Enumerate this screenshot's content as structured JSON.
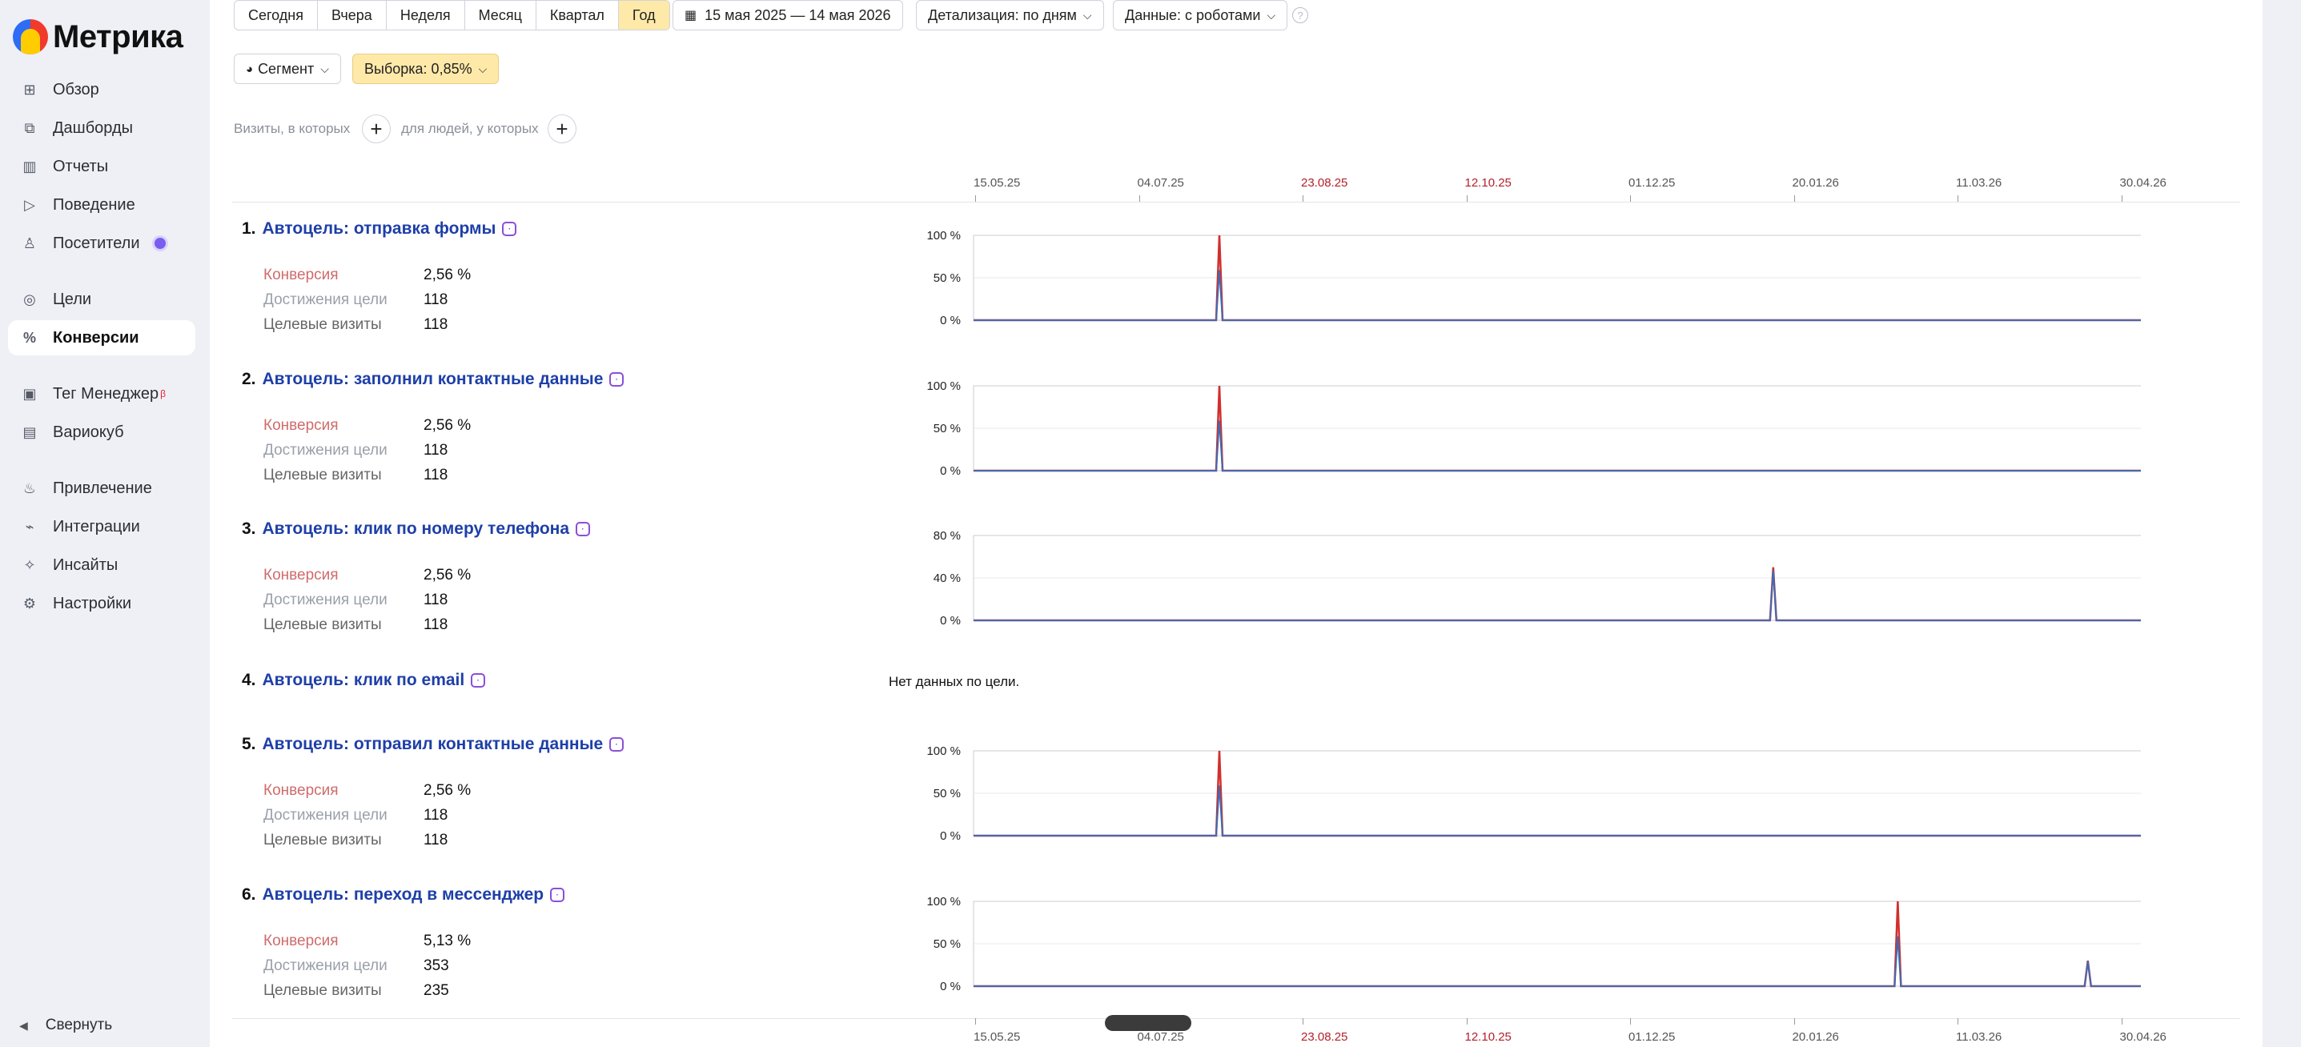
{
  "app": {
    "logo_text": "Метрика"
  },
  "sidebar": {
    "items": [
      {
        "label": "Обзор",
        "icon": "grid-icon",
        "glyph": "⊞"
      },
      {
        "label": "Дашборды",
        "icon": "dashboards-icon",
        "glyph": "⧉"
      },
      {
        "label": "Отчеты",
        "icon": "bar-chart-icon",
        "glyph": "▥"
      },
      {
        "label": "Поведение",
        "icon": "play-icon",
        "glyph": "▷"
      },
      {
        "label": "Посетители",
        "icon": "user-icon",
        "glyph": "♙"
      },
      {
        "label": "Цели",
        "icon": "target-icon",
        "glyph": "◎"
      },
      {
        "label": "Конверсии",
        "icon": "percent-icon",
        "glyph": "%"
      },
      {
        "label": "Тег Менеджер",
        "icon": "tag-manager-icon",
        "glyph": "▣",
        "badge": "β"
      },
      {
        "label": "Вариокуб",
        "icon": "variocube-icon",
        "glyph": "▤"
      },
      {
        "label": "Привлечение",
        "icon": "fire-icon",
        "glyph": "♨"
      },
      {
        "label": "Интеграции",
        "icon": "plug-icon",
        "glyph": "⌁"
      },
      {
        "label": "Инсайты",
        "icon": "wand-icon",
        "glyph": "✧"
      },
      {
        "label": "Настройки",
        "icon": "gear-icon",
        "glyph": "⚙"
      }
    ],
    "collapse_label": "Свернуть"
  },
  "toolbar": {
    "periods": [
      "Сегодня",
      "Вчера",
      "Неделя",
      "Месяц",
      "Квартал",
      "Год"
    ],
    "active_period": "Год",
    "date_range": "15 мая 2025 — 14 мая 2026",
    "detail": "Детализация: по дням",
    "robots": "Данные: с роботами",
    "segment": "Сегмент",
    "sample": "Выборка: 0,85%"
  },
  "filters": {
    "visits_label": "Визиты, в которых",
    "people_label": "для людей, у которых"
  },
  "axis_dates": [
    {
      "label": "15.05.25",
      "red": false
    },
    {
      "label": "04.07.25",
      "red": false
    },
    {
      "label": "23.08.25",
      "red": true
    },
    {
      "label": "12.10.25",
      "red": true
    },
    {
      "label": "01.12.25",
      "red": false
    },
    {
      "label": "20.01.26",
      "red": false
    },
    {
      "label": "11.03.26",
      "red": false
    },
    {
      "label": "30.04.26",
      "red": false
    }
  ],
  "metric_labels": {
    "conversion": "Конверсия",
    "achievements": "Достижения цели",
    "visits": "Целевые визиты"
  },
  "goals": [
    {
      "num": "1.",
      "title": "Автоцель: отправка формы",
      "icon": "form-icon",
      "conversion": "2,56 %",
      "achievements": "118",
      "visits": "118"
    },
    {
      "num": "2.",
      "title": "Автоцель: заполнил контактные данные",
      "icon": "contact-icon",
      "conversion": "2,56 %",
      "achievements": "118",
      "visits": "118"
    },
    {
      "num": "3.",
      "title": "Автоцель: клик по номеру телефона",
      "icon": "phone-icon",
      "conversion": "2,56 %",
      "achievements": "118",
      "visits": "118"
    },
    {
      "num": "4.",
      "title": "Автоцель: клик по email",
      "icon": "email-icon",
      "no_data": "Нет данных по цели."
    },
    {
      "num": "5.",
      "title": "Автоцель: отправил контактные данные",
      "icon": "contact-icon",
      "conversion": "2,56 %",
      "achievements": "118",
      "visits": "118"
    },
    {
      "num": "6.",
      "title": "Автоцель: переход в мессенджер",
      "icon": "messenger-icon",
      "conversion": "5,13 %",
      "achievements": "353",
      "visits": "235"
    }
  ],
  "chart_data": [
    {
      "type": "line",
      "goal": "Автоцель: отправка формы",
      "x_range": [
        "15.05.25",
        "14.05.26"
      ],
      "left_ticks": [
        "100 %",
        "50 %",
        "0 %"
      ],
      "right_ticks": [
        "200",
        "100",
        "0"
      ],
      "series": [
        {
          "color": "#d0302c",
          "peaks": [
            {
              "x": "29.07.25",
              "value": 100
            }
          ]
        },
        {
          "color": "#3f6bb5",
          "peaks": [
            {
              "x": "29.07.25",
              "value": 118
            }
          ]
        }
      ]
    },
    {
      "type": "line",
      "goal": "Автоцель: заполнил контактные данные",
      "x_range": [
        "15.05.25",
        "14.05.26"
      ],
      "left_ticks": [
        "100 %",
        "50 %",
        "0 %"
      ],
      "right_ticks": [
        "200",
        "100",
        "0"
      ],
      "series": [
        {
          "color": "#d0302c",
          "peaks": [
            {
              "x": "29.07.25",
              "value": 100
            }
          ]
        },
        {
          "color": "#3f6bb5",
          "peaks": [
            {
              "x": "29.07.25",
              "value": 118
            }
          ]
        }
      ]
    },
    {
      "type": "line",
      "goal": "Автоцель: клик по номеру телефона",
      "x_range": [
        "15.05.25",
        "14.05.26"
      ],
      "left_ticks": [
        "80 %",
        "40 %",
        "0 %"
      ],
      "right_ticks": [
        "200",
        "100",
        "0"
      ],
      "series": [
        {
          "color": "#d0302c",
          "peaks": [
            {
              "x": "14.01.26",
              "value": 50
            }
          ]
        },
        {
          "color": "#3f6bb5",
          "peaks": [
            {
              "x": "14.01.26",
              "value": 118
            }
          ]
        }
      ]
    },
    {
      "type": "line",
      "goal": "Автоцель: отправил контактные данные",
      "x_range": [
        "15.05.25",
        "14.05.26"
      ],
      "left_ticks": [
        "100 %",
        "50 %",
        "0 %"
      ],
      "right_ticks": [
        "200",
        "100",
        "0"
      ],
      "series": [
        {
          "color": "#d0302c",
          "peaks": [
            {
              "x": "29.07.25",
              "value": 100
            }
          ]
        },
        {
          "color": "#3f6bb5",
          "peaks": [
            {
              "x": "29.07.25",
              "value": 118
            }
          ]
        }
      ]
    },
    {
      "type": "line",
      "goal": "Автоцель: переход в мессенджер",
      "x_range": [
        "15.05.25",
        "14.05.26"
      ],
      "left_ticks": [
        "100 %",
        "50 %",
        "0 %"
      ],
      "right_ticks": [
        "400",
        "200",
        "0"
      ],
      "series": [
        {
          "color": "#d0302c",
          "peaks": [
            {
              "x": "21.02.26",
              "value": 100
            },
            {
              "x": "20.04.26",
              "value": 30
            }
          ]
        },
        {
          "color": "#3f6bb5",
          "peaks": [
            {
              "x": "21.02.26",
              "value": 235
            },
            {
              "x": "20.04.26",
              "value": 118
            }
          ]
        }
      ]
    }
  ],
  "colors": {
    "conversion_line": "#d0302c",
    "visits_line": "#3f6bb5",
    "accent_yellow": "#ffe9a8",
    "link_blue": "#1e3fa8"
  }
}
